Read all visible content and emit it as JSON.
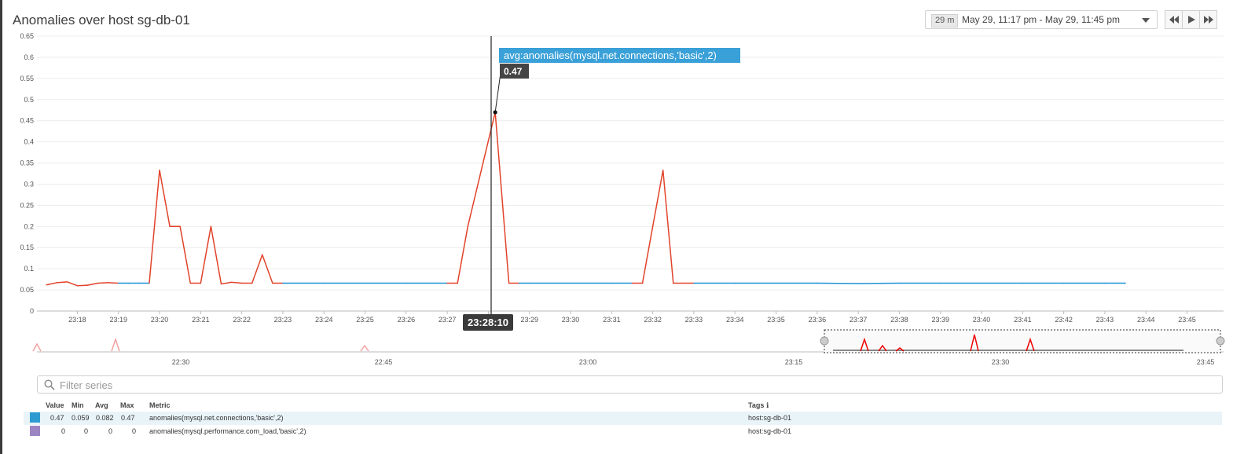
{
  "title": "Anomalies over host sg-db-01",
  "timepicker": {
    "duration": "29 m",
    "range": "May 29, 11:17 pm - May 29, 11:45 pm"
  },
  "nav": {
    "back_icon": "rewind-icon",
    "play_icon": "play-icon",
    "forward_icon": "fast-forward-icon"
  },
  "chart_data": {
    "type": "line",
    "y_ticks": [
      "0.65",
      "0.6",
      "0.55",
      "0.5",
      "0.45",
      "0.4",
      "0.35",
      "0.3",
      "0.25",
      "0.2",
      "0.15",
      "0.1",
      "0.05",
      "0"
    ],
    "ylim": [
      0,
      0.65
    ],
    "x_ticks": [
      "23:18",
      "23:19",
      "23:20",
      "23:21",
      "23:22",
      "23:23",
      "23:24",
      "23:25",
      "23:26",
      "23:27",
      "23:28",
      "23:29",
      "23:30",
      "23:31",
      "23:32",
      "23:33",
      "23:34",
      "23:35",
      "23:36",
      "23:37",
      "23:38",
      "23:39",
      "23:40",
      "23:41",
      "23:42",
      "23:43",
      "23:44",
      "23:45"
    ],
    "grid": true,
    "series": [
      {
        "metric": "anomalies(mysql.net.connections,'basic',2)",
        "color": "#1f8fd6",
        "anomaly_color": "#e1432a",
        "x": [
          "23:17:15",
          "23:17:30",
          "23:17:45",
          "23:18:00",
          "23:18:15",
          "23:18:30",
          "23:18:45",
          "23:19:00",
          "23:19:15",
          "23:19:30",
          "23:19:45",
          "23:20:00",
          "23:20:15",
          "23:20:30",
          "23:20:45",
          "23:21:00",
          "23:21:15",
          "23:21:30",
          "23:21:45",
          "23:22:00",
          "23:22:15",
          "23:22:30",
          "23:22:45",
          "23:23:00",
          "23:24:00",
          "23:25:00",
          "23:26:00",
          "23:27:00",
          "23:27:15",
          "23:27:30",
          "23:28:10",
          "23:28:30",
          "23:28:45",
          "23:29:00",
          "23:30:00",
          "23:31:00",
          "23:31:30",
          "23:31:45",
          "23:32:00",
          "23:32:15",
          "23:32:30",
          "23:33:00",
          "23:34:00",
          "23:35:00",
          "23:36:00",
          "23:37:00",
          "23:38:00",
          "23:39:00",
          "23:40:00",
          "23:41:00",
          "23:42:00",
          "23:43:00",
          "23:43:30"
        ],
        "y": [
          0.062,
          0.067,
          0.069,
          0.06,
          0.061,
          0.066,
          0.067,
          0.066,
          0.066,
          0.066,
          0.066,
          0.333,
          0.2,
          0.2,
          0.066,
          0.066,
          0.2,
          0.064,
          0.068,
          0.066,
          0.066,
          0.133,
          0.066,
          0.066,
          0.066,
          0.066,
          0.066,
          0.066,
          0.066,
          0.2,
          0.47,
          0.066,
          0.066,
          0.066,
          0.066,
          0.066,
          0.066,
          0.066,
          0.2,
          0.333,
          0.066,
          0.066,
          0.066,
          0.066,
          0.066,
          0.065,
          0.066,
          0.066,
          0.066,
          0.066,
          0.066,
          0.066,
          0.066
        ],
        "anomalous": [
          true,
          true,
          true,
          true,
          true,
          true,
          true,
          false,
          false,
          false,
          false,
          true,
          true,
          true,
          true,
          true,
          true,
          true,
          true,
          true,
          true,
          true,
          true,
          false,
          false,
          false,
          false,
          false,
          true,
          true,
          true,
          true,
          false,
          false,
          false,
          false,
          false,
          true,
          true,
          true,
          true,
          false,
          false,
          false,
          false,
          false,
          false,
          false,
          false,
          false,
          false,
          false,
          false
        ]
      }
    ],
    "tooltip": {
      "label": "avg:anomalies(mysql.net.connections,'basic',2)",
      "value": "0.47",
      "time": "23:28:10"
    },
    "overview": {
      "x_ticks": [
        "22:30",
        "22:45",
        "23:00",
        "23:15",
        "23:30",
        "23:45"
      ]
    }
  },
  "filter": {
    "placeholder": "Filter series"
  },
  "legend": {
    "headers": {
      "value": "Value",
      "min": "Min",
      "avg": "Avg",
      "max": "Max",
      "metric": "Metric",
      "tags": "Tags ℹ"
    },
    "rows": [
      {
        "color": "#2e9bd0",
        "value": "0.47",
        "min": "0.059",
        "avg": "0.082",
        "max": "0.47",
        "metric": "anomalies(mysql.net.connections,'basic',2)",
        "tags": "host:sg-db-01"
      },
      {
        "color": "#9b85c2",
        "value": "0",
        "min": "0",
        "avg": "0",
        "max": "0",
        "metric": "anomalies(mysql.performance.com_load,'basic',2)",
        "tags": "host:sg-db-01"
      }
    ]
  }
}
